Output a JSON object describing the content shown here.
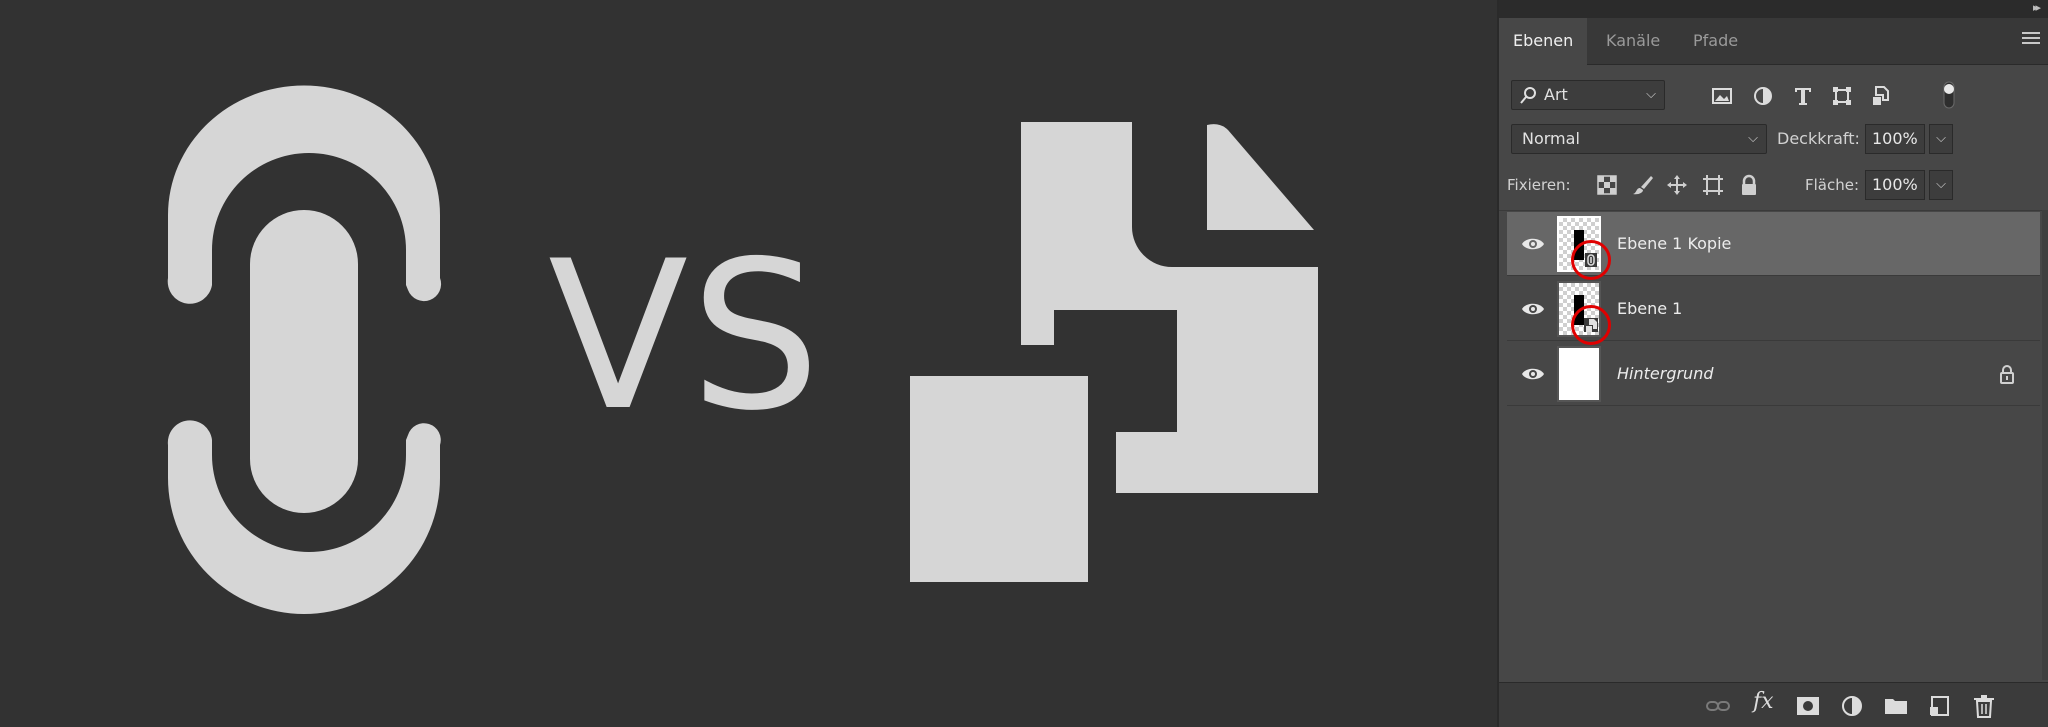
{
  "canvas": {
    "vs_text": "VS",
    "link_icon": "chain-link-icon",
    "embed_icon": "document-copy-icon",
    "fill_color": "#d6d6d6",
    "background_color": "#323232"
  },
  "panel": {
    "collapse_icon": "double-chevron-right-icon",
    "tabs": [
      {
        "label": "Ebenen",
        "active": true
      },
      {
        "label": "Kanäle",
        "active": false
      },
      {
        "label": "Pfade",
        "active": false
      }
    ],
    "menu_icon": "panel-menu-icon",
    "filter": {
      "kind_label": "Art",
      "icons": [
        "image-filter-icon",
        "adjustment-filter-icon",
        "type-filter-icon",
        "shape-filter-icon",
        "smart-object-filter-icon"
      ],
      "toggle_icon": "filter-toggle-icon"
    },
    "blend": {
      "mode": "Normal",
      "opacity_label": "Deckkraft:",
      "opacity_value": "100%"
    },
    "lock": {
      "label": "Fixieren:",
      "icons": [
        "lock-transparent-icon",
        "lock-paint-icon",
        "lock-position-icon",
        "lock-artboard-icon",
        "lock-all-icon"
      ],
      "fill_label": "Fläche:",
      "fill_value": "100%"
    },
    "layers": [
      {
        "name": "Ebene 1 Kopie",
        "selected": true,
        "italic": false,
        "badge": "linked-smart-object-icon"
      },
      {
        "name": "Ebene 1",
        "selected": false,
        "italic": false,
        "badge": "embedded-smart-object-icon"
      },
      {
        "name": "Hintergrund",
        "selected": false,
        "italic": true,
        "badge": "lock-icon"
      }
    ],
    "bottom_icons": [
      "link-layers-icon",
      "fx-icon",
      "layer-mask-icon",
      "adjustment-layer-icon",
      "group-folder-icon",
      "new-layer-icon",
      "trash-icon"
    ],
    "fx_text": "fx"
  }
}
